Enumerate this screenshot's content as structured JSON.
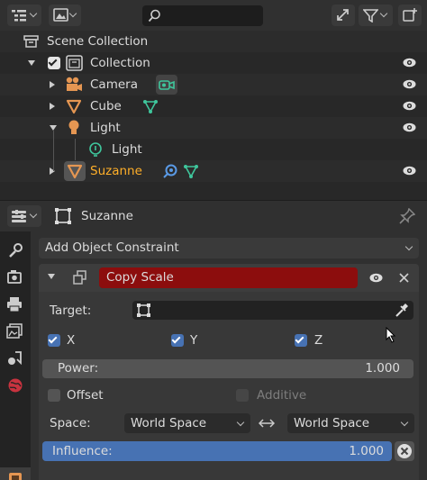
{
  "outliner": {
    "items": [
      {
        "label": "Scene Collection"
      },
      {
        "label": "Collection"
      },
      {
        "label": "Camera"
      },
      {
        "label": "Cube"
      },
      {
        "label": "Light"
      },
      {
        "label": "Light"
      },
      {
        "label": "Suzanne"
      }
    ]
  },
  "properties": {
    "object_name": "Suzanne",
    "add_constraint_label": "Add Object Constraint",
    "constraint": {
      "name": "Copy Scale",
      "target_label": "Target:",
      "target_value": "",
      "axes": [
        {
          "label": "X",
          "checked": true
        },
        {
          "label": "Y",
          "checked": true
        },
        {
          "label": "Z",
          "checked": true
        }
      ],
      "power_label": "Power:",
      "power_value": "1.000",
      "offset_label": "Offset",
      "offset_checked": false,
      "additive_label": "Additive",
      "additive_checked": false,
      "space_label": "Space:",
      "owner_space": "World Space",
      "target_space": "World Space",
      "influence_label": "Influence:",
      "influence_value": "1.000"
    }
  },
  "colors": {
    "accent": "#4772b3",
    "constraint_header": "#8c0d0d",
    "selected_text": "#ffaf29",
    "icon_orange": "#e59652",
    "icon_green": "#3fc69c"
  },
  "icons": [
    "editor-type-icon",
    "display-mode-icon",
    "search-icon",
    "filter-icon",
    "sync-icon",
    "add-collection-icon",
    "eye-icon",
    "camera-icon",
    "mesh-icon",
    "light-icon",
    "pin-icon",
    "close-icon",
    "eyedropper-icon"
  ]
}
